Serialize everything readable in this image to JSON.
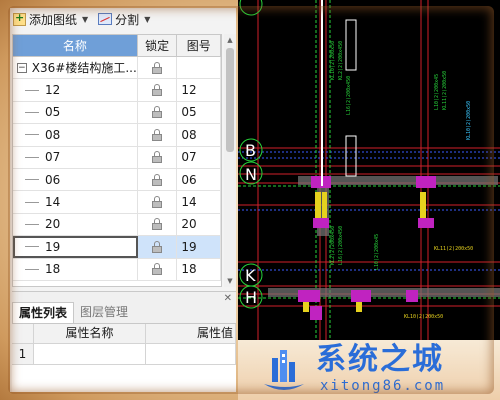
{
  "toolbar": {
    "add_label": "添加图纸",
    "split_label": "分割"
  },
  "grid": {
    "columns": [
      "名称",
      "锁定",
      "图号"
    ],
    "root": {
      "name": "X36#楼结构施工...",
      "num": ""
    },
    "rows": [
      {
        "name": "12",
        "num": "12"
      },
      {
        "name": "05",
        "num": "05"
      },
      {
        "name": "08",
        "num": "08"
      },
      {
        "name": "07",
        "num": "07"
      },
      {
        "name": "06",
        "num": "06"
      },
      {
        "name": "14",
        "num": "14"
      },
      {
        "name": "20",
        "num": "20"
      },
      {
        "name": "19",
        "num": "19"
      },
      {
        "name": "18",
        "num": "18"
      }
    ],
    "selected_index": 7
  },
  "bottom_panel": {
    "tabs": [
      {
        "label": "属性列表",
        "active": true
      },
      {
        "label": "图层管理",
        "active": false
      }
    ],
    "columns": [
      "属性名称",
      "属性值"
    ],
    "rows": [
      {
        "index": "1",
        "name": "",
        "value": ""
      }
    ]
  },
  "cad": {
    "axis_labels": [
      "B",
      "N",
      "K",
      "H"
    ],
    "annotations": [
      "KL10(2)200x50",
      "KL2(2)200x450",
      "L16(2)200x450",
      "L10(2)200x45",
      "KL11(2)200x50"
    ]
  },
  "watermark": {
    "title": "系统之城",
    "url": "xitong86.com"
  },
  "colors": {
    "header_blue": "#6f9fd8",
    "selected_row": "#cfe3fa",
    "cad_background": "#000000",
    "cad_green": "#27d23a",
    "cad_red": "#d0202a",
    "cad_yellow": "#e6d21e",
    "cad_magenta": "#c023c0",
    "watermark_blue": "#2a6dd8"
  }
}
